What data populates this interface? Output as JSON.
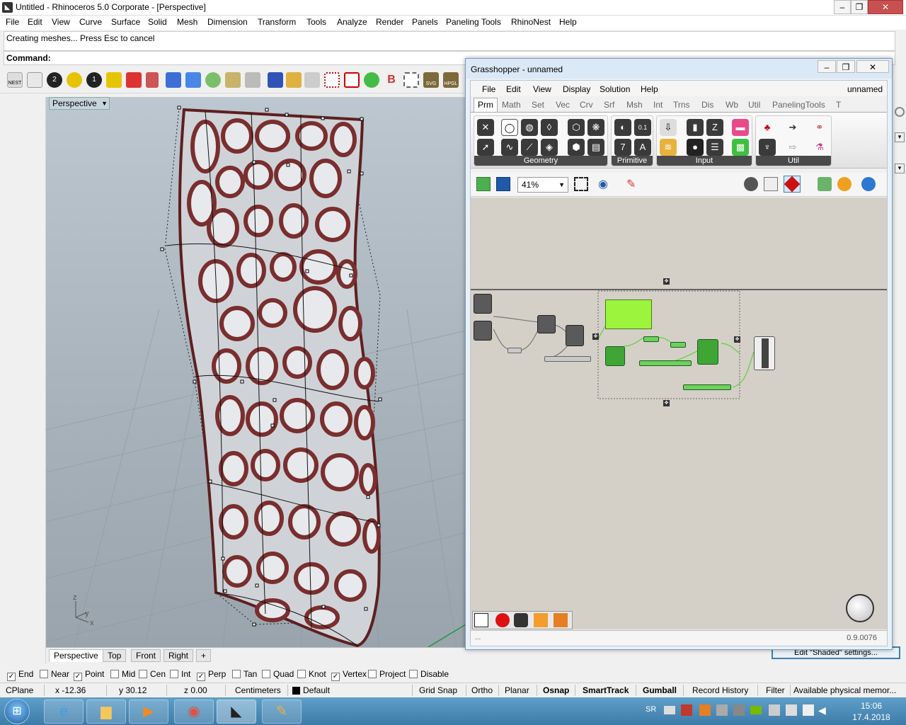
{
  "rhino": {
    "title": "Untitled - Rhinoceros  5.0 Corporate - [Perspective]",
    "menu": [
      "File",
      "Edit",
      "View",
      "Curve",
      "Surface",
      "Solid",
      "Mesh",
      "Dimension",
      "Transform",
      "Tools",
      "Analyze",
      "Render",
      "Panels",
      "Paneling Tools",
      "RhinoNest",
      "Help"
    ],
    "command_history": "Creating meshes... Press Esc to cancel",
    "command_prompt": "Command:",
    "viewport_label": "Perspective",
    "viewport_tabs": [
      "Perspective",
      "Top",
      "Front",
      "Right"
    ],
    "axis": {
      "x": "x",
      "y": "y",
      "z": "z"
    },
    "toolbar_labels": {
      "nest": "NEST",
      "svg": "SVG",
      "hpgl": "HPGL",
      "one": "1",
      "two": "2"
    }
  },
  "osnap": [
    {
      "label": "End",
      "checked": true
    },
    {
      "label": "Near",
      "checked": false
    },
    {
      "label": "Point",
      "checked": true
    },
    {
      "label": "Mid",
      "checked": false
    },
    {
      "label": "Cen",
      "checked": false
    },
    {
      "label": "Int",
      "checked": false
    },
    {
      "label": "Perp",
      "checked": true
    },
    {
      "label": "Tan",
      "checked": false
    },
    {
      "label": "Quad",
      "checked": false
    },
    {
      "label": "Knot",
      "checked": false
    },
    {
      "label": "Vertex",
      "checked": true
    },
    {
      "label": "Project",
      "checked": false
    },
    {
      "label": "Disable",
      "checked": false
    }
  ],
  "status": {
    "cplane": "CPlane",
    "x": "x -12.36",
    "y": "y 30.12",
    "z": "z 0.00",
    "units": "Centimeters",
    "layer": "Default",
    "grid_snap": "Grid Snap",
    "ortho": "Ortho",
    "planar": "Planar",
    "osnap": "Osnap",
    "smarttrack": "SmartTrack",
    "gumball": "Gumball",
    "record_history": "Record History",
    "filter": "Filter",
    "memory": "Available physical memor...",
    "edit_shaded": "Edit \"Shaded\" settings..."
  },
  "grasshopper": {
    "title": "Grasshopper - unnamed",
    "menu": [
      "File",
      "Edit",
      "View",
      "Display",
      "Solution",
      "Help"
    ],
    "doc_name": "unnamed",
    "tabs": [
      "Prm",
      "Math",
      "Set",
      "Vec",
      "Crv",
      "Srf",
      "Msh",
      "Int",
      "Trns",
      "Dis",
      "Wb",
      "Util",
      "PanelingTools",
      "T"
    ],
    "groups": [
      "Geometry",
      "Primitive",
      "Input",
      "Util"
    ],
    "primitive_icons": [
      "0.1",
      "7",
      "A"
    ],
    "zoom": "41%",
    "version": "0.9.0076",
    "status_left": "..."
  },
  "taskbar": {
    "tray_lang": "SR",
    "time": "15:06",
    "date": "17.4.2018"
  },
  "colors": {
    "viewport_bg": "#a8b3bc",
    "mesh_red": "#7a2e2e",
    "gh_green": "#3fa535",
    "gh_panel_green": "#9cf53c",
    "taskbar": "#4a8bbd"
  }
}
